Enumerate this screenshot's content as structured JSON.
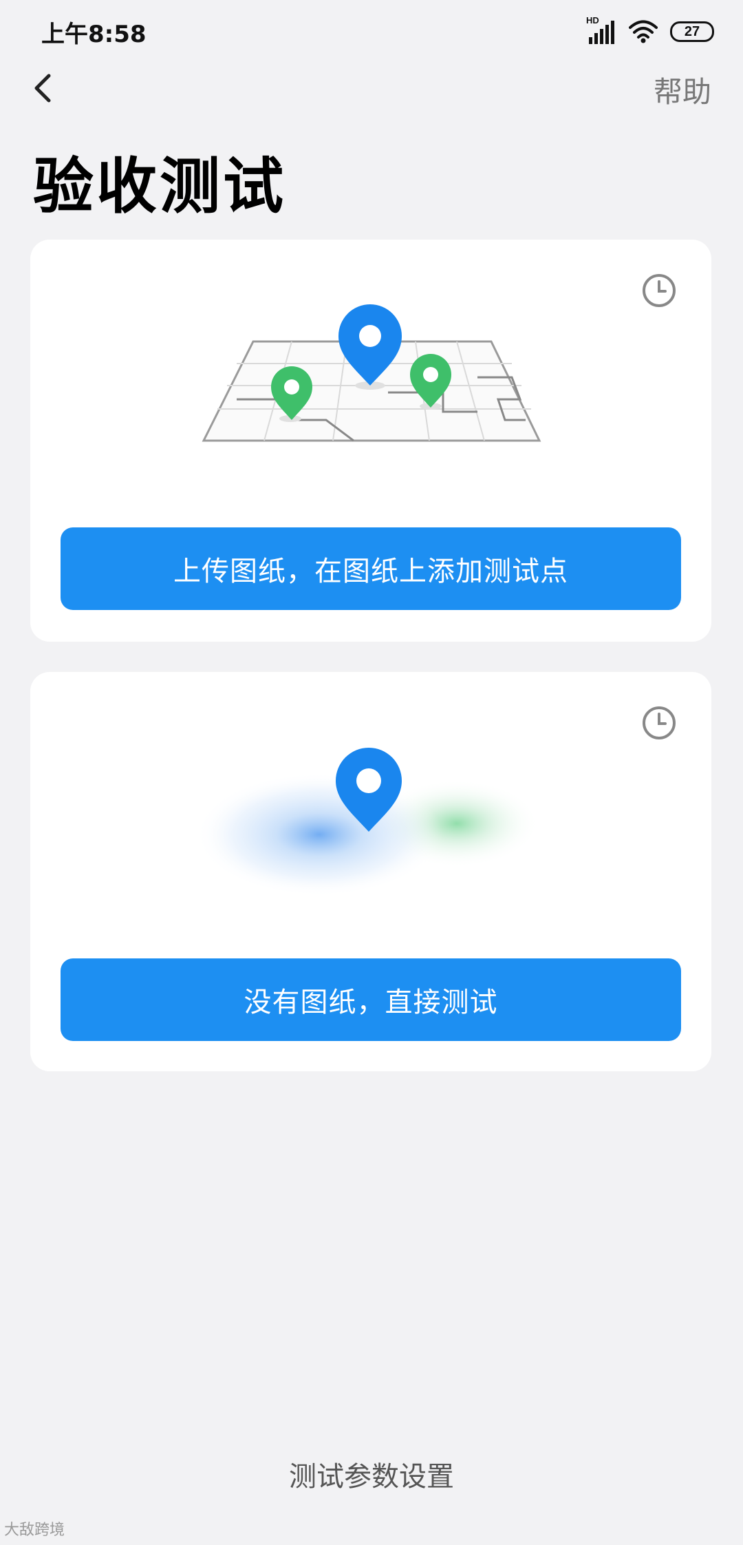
{
  "status_bar": {
    "time": "上午8:58",
    "network_label": "HD",
    "battery_level": "27",
    "icons": [
      "signal-icon",
      "wifi-icon",
      "battery-icon"
    ]
  },
  "header": {
    "back_icon": "chevron-left-icon",
    "help_label": "帮助"
  },
  "page": {
    "title": "验收测试"
  },
  "cards": [
    {
      "illustration": "floor-plan-map-with-pins",
      "history_icon": "clock-icon",
      "button_label": "上传图纸，在图纸上添加测试点"
    },
    {
      "illustration": "single-pin-with-signal-heatmap",
      "history_icon": "clock-icon",
      "button_label": "没有图纸，直接测试"
    }
  ],
  "footer": {
    "settings_label": "测试参数设置",
    "watermark": "大敌跨境"
  },
  "colors": {
    "accent": "#1d8ff2",
    "pin_blue": "#1a86ee",
    "pin_green": "#3fbf6a",
    "background": "#f2f2f4",
    "card": "#ffffff",
    "muted_text": "#777777"
  }
}
